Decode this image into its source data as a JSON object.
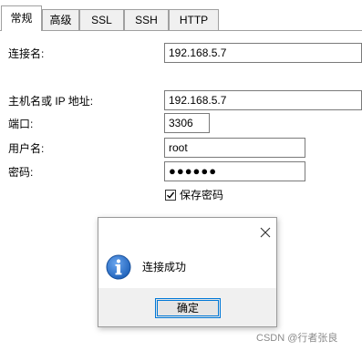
{
  "tabs": [
    "常规",
    "高级",
    "SSL",
    "SSH",
    "HTTP"
  ],
  "active_tab": "常规",
  "form": {
    "connection_name_label": "连接名:",
    "connection_name_value": "192.168.5.7",
    "host_label": "主机名或 IP 地址:",
    "host_value": "192.168.5.7",
    "port_label": "端口:",
    "port_value": "3306",
    "username_label": "用户名:",
    "username_value": "root",
    "password_label": "密码:",
    "password_value": "●●●●●●",
    "save_password_label": "保存密码",
    "save_password_checked": true
  },
  "dialog": {
    "message": "连接成功",
    "ok_label": "确定",
    "icon": "info-icon",
    "close_icon": "close-icon"
  },
  "watermark": "CSDN @行者张良",
  "colors": {
    "focus_border": "#0078d7",
    "info_icon_blue": "#1c5fb8"
  }
}
